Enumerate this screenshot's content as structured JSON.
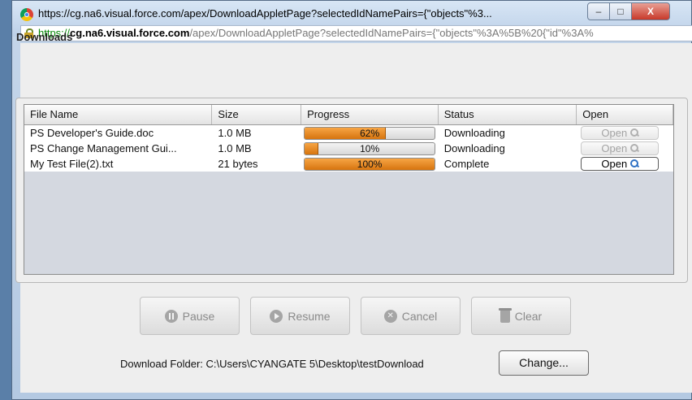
{
  "window": {
    "title": "https://cg.na6.visual.force.com/apex/DownloadAppletPage?selectedIdNamePairs={\"objects\"%3...",
    "controls": {
      "minimize": "–",
      "maximize": "□",
      "close": "X"
    }
  },
  "address": {
    "scheme": "https://",
    "host": "cg.na6.visual.force.com",
    "path": "/apex/DownloadAppletPage?selectedIdNamePairs={\"objects\"%3A%5B%20{\"id\"%3A%"
  },
  "panel": {
    "title": "Downloads"
  },
  "table": {
    "headers": [
      "File Name",
      "Size",
      "Progress",
      "Status",
      "Open"
    ],
    "rows": [
      {
        "name": "PS Developer's Guide.doc",
        "size": "1.0 MB",
        "progress": 62,
        "progress_label": "62%",
        "status": "Downloading",
        "open_label": "Open",
        "open_enabled": false
      },
      {
        "name": "PS Change Management Gui...",
        "size": "1.0 MB",
        "progress": 10,
        "progress_label": "10%",
        "status": "Downloading",
        "open_label": "Open",
        "open_enabled": false
      },
      {
        "name": "My Test File(2).txt",
        "size": "21 bytes",
        "progress": 100,
        "progress_label": "100%",
        "status": "Complete",
        "open_label": "Open",
        "open_enabled": true
      }
    ]
  },
  "actions": {
    "pause": "Pause",
    "resume": "Resume",
    "cancel": "Cancel",
    "clear": "Clear"
  },
  "folder": {
    "label": "Download Folder: C:\\Users\\CYANGATE 5\\Desktop\\testDownload",
    "change": "Change..."
  },
  "colors": {
    "progress_fill": "#e8891c",
    "accent_https": "#0a8a0a"
  },
  "icons": [
    "chrome-icon",
    "lock-icon",
    "magnifier-icon",
    "pause-icon",
    "play-icon",
    "cancel-icon",
    "trash-icon"
  ]
}
